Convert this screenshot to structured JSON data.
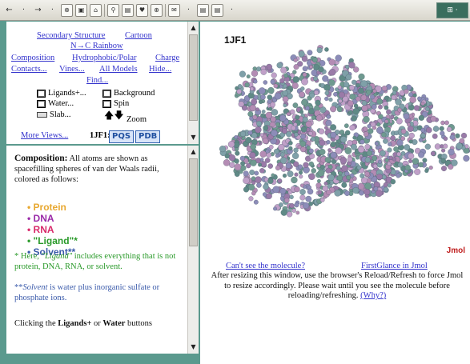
{
  "toolbar": {
    "items": [
      "←",
      "·",
      "→",
      "·",
      "⊗",
      "▣",
      "⌂",
      "⚲",
      "▤",
      "♥",
      "⊕",
      "▤",
      "✉",
      "▤"
    ],
    "right_label": "⊞ ·"
  },
  "controls": {
    "secondary_structure": "Secondary Structure",
    "cartoon": "Cartoon",
    "n_c_rainbow": "N→C Rainbow",
    "composition": "Composition",
    "hydrophobic_polar": "Hydrophobic/Polar",
    "charge": "Charge",
    "contacts": "Contacts...",
    "vines": "Vines...",
    "all_models": "All Models",
    "hide": "Hide...",
    "find": "Find...",
    "ligands": "Ligands+...",
    "background": "Background",
    "water": "Water...",
    "spin": "Spin",
    "slab": "Slab...",
    "zoom": "Zoom",
    "more_views": "More Views...",
    "pdb_id_label": "1JF1:",
    "pqs": "PQS",
    "pdb": "PDB"
  },
  "composition_panel": {
    "heading": "Composition:",
    "intro": "All atoms are shown as spacefilling spheres of van der Waals radii, colored as follows:",
    "legend": [
      {
        "label": "Protein",
        "color": "#e8a830"
      },
      {
        "label": "DNA",
        "color": "#9a2aa8"
      },
      {
        "label": "RNA",
        "color": "#d82a6a"
      },
      {
        "label": "\"Ligand\"*",
        "color": "#2a9a2a"
      },
      {
        "label": "Solvent**",
        "color": "#3a5aaa"
      }
    ],
    "note_ligand_prefix": "* Here, ",
    "note_ligand_word": "\"Ligand\"",
    "note_ligand_rest": " includes everything that is not protein, DNA, RNA, or solvent.",
    "note_solvent_prefix": "**",
    "note_solvent_word": "Solvent",
    "note_solvent_rest": " is water plus inorganic sulfate or phosphate ions.",
    "clicking_a": "Clicking the ",
    "clicking_b": "Ligands+",
    "clicking_c": " or ",
    "clicking_d": "Water",
    "clicking_e": " buttons"
  },
  "viewer": {
    "title": "1JF1",
    "jmol_label": "Jmol",
    "cant_see": "Can't see the molecule?",
    "firstglance": "FirstGlance in Jmol",
    "instructions": "After resizing this window, use the browser's Reload/Refresh to force Jmol to resize accordingly. Please wait until you see the molecule before reloading/refreshing.",
    "why": "(Why?)"
  }
}
